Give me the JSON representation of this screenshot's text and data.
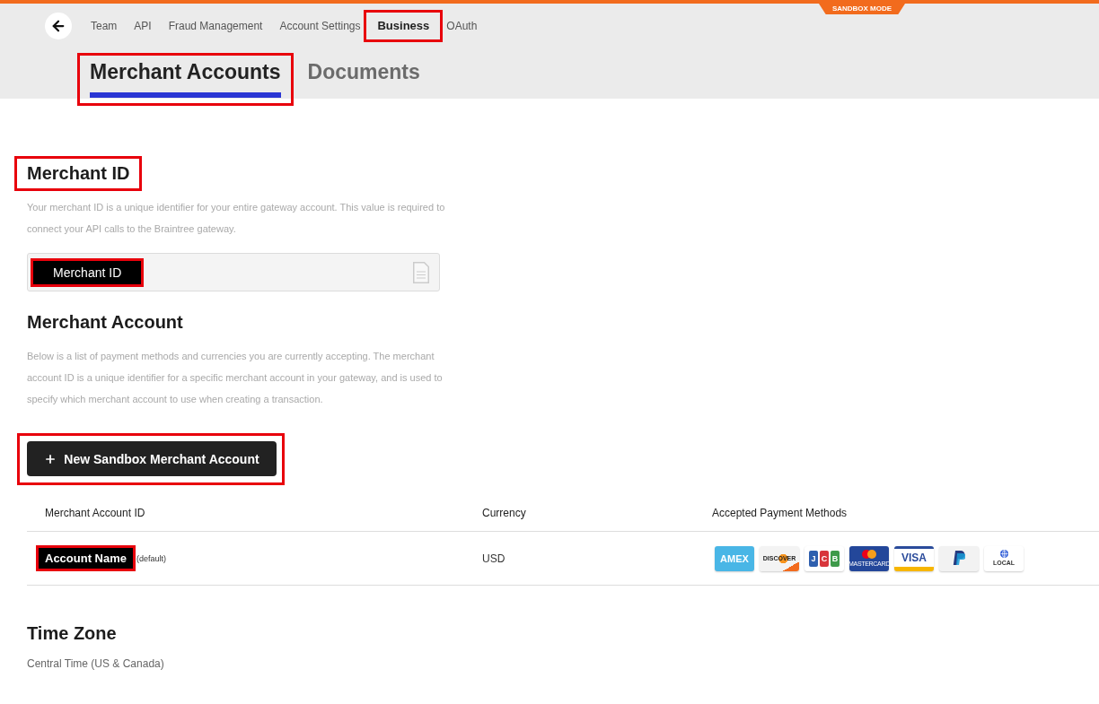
{
  "banner": {
    "label": "SANDBOX MODE"
  },
  "nav": {
    "items": [
      {
        "label": "Team",
        "selected": false,
        "highlighted": false
      },
      {
        "label": "API",
        "selected": false,
        "highlighted": false
      },
      {
        "label": "Fraud Management",
        "selected": false,
        "highlighted": false
      },
      {
        "label": "Account Settings",
        "selected": false,
        "highlighted": false
      },
      {
        "label": "Business",
        "selected": true,
        "highlighted": true
      },
      {
        "label": "OAuth",
        "selected": false,
        "highlighted": false
      }
    ]
  },
  "tabs": [
    {
      "label": "Merchant Accounts",
      "selected": true,
      "highlighted": true
    },
    {
      "label": "Documents",
      "selected": false,
      "highlighted": false
    }
  ],
  "merchant_id": {
    "heading": {
      "text": "Merchant ID",
      "highlighted": true
    },
    "description": "Your merchant ID is a unique identifier for your entire gateway account. This value is required to connect your API calls to the Braintree gateway.",
    "field": {
      "value": "Merchant ID",
      "redacted": true,
      "highlighted": true
    }
  },
  "merchant_account": {
    "heading": {
      "text": "Merchant Account",
      "highlighted": false
    },
    "description": "Below is a list of payment methods and currencies you are currently accepting. The merchant account ID is a unique identifier for a specific merchant account in your gateway, and is used to specify which merchant account to use when creating a transaction.",
    "button": {
      "label": "New Sandbox Merchant Account",
      "highlighted": true
    }
  },
  "table": {
    "columns": [
      "Merchant Account ID",
      "Currency",
      "Accepted Payment Methods"
    ],
    "rows": [
      {
        "account": {
          "value": "Account Name",
          "redacted": true,
          "highlighted": true
        },
        "note": "(default)",
        "currency": "USD",
        "payment_methods": [
          {
            "kind": "filled",
            "label": "AMEX"
          },
          {
            "kind": "swoosh",
            "label": "DISCOVER"
          },
          {
            "kind": "tiles",
            "letters": [
              {
                "letter": "J",
                "color": "#2f5fae"
              },
              {
                "letter": "C",
                "color": "#d8353b"
              },
              {
                "letter": "B",
                "color": "#3e9a4a"
              }
            ]
          },
          {
            "kind": "circles",
            "label": "MASTERCARD"
          },
          {
            "kind": "striped",
            "label": "VISA"
          },
          {
            "kind": "logo"
          },
          {
            "kind": "globe",
            "label": "LOCAL"
          }
        ]
      }
    ]
  },
  "time_zone": {
    "heading": {
      "text": "Time Zone",
      "highlighted": false
    },
    "value": "Central Time (US & Canada)"
  }
}
